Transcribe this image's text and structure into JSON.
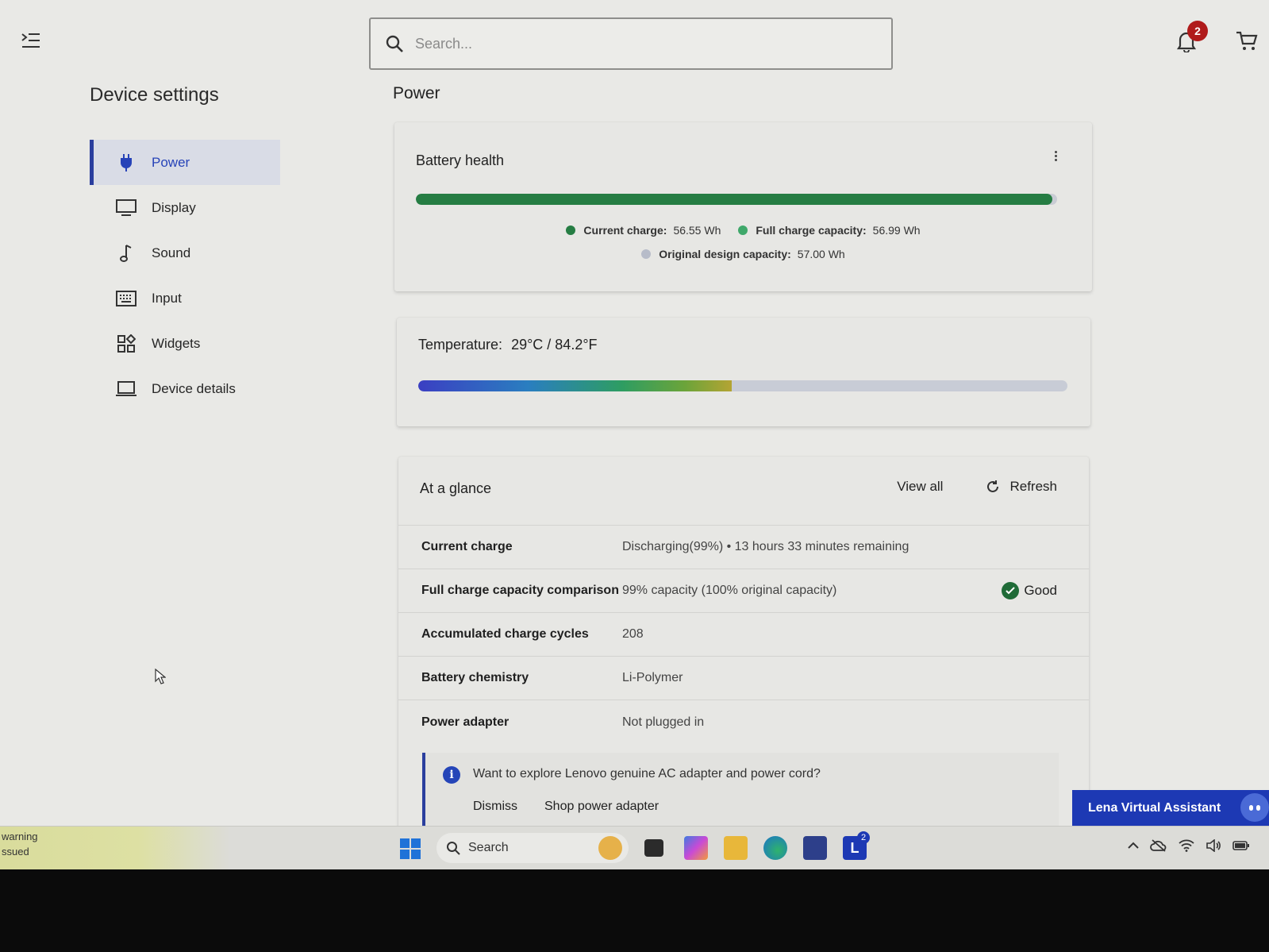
{
  "topbar": {
    "search_placeholder": "Search...",
    "notification_count": "2"
  },
  "sidebar": {
    "title": "Device settings",
    "items": [
      {
        "label": "Power",
        "icon": "plug-icon",
        "active": true
      },
      {
        "label": "Display",
        "icon": "monitor-icon"
      },
      {
        "label": "Sound",
        "icon": "music-note-icon"
      },
      {
        "label": "Input",
        "icon": "keyboard-icon"
      },
      {
        "label": "Widgets",
        "icon": "widgets-icon"
      },
      {
        "label": "Device details",
        "icon": "laptop-icon"
      }
    ]
  },
  "page": {
    "title": "Power"
  },
  "battery_health": {
    "title": "Battery health",
    "charge_fraction": 0.992,
    "legend": [
      {
        "label": "Current charge:",
        "value": "56.55 Wh",
        "color": "#267d43"
      },
      {
        "label": "Full charge capacity:",
        "value": "56.99 Wh",
        "color": "#3fa86a"
      },
      {
        "label": "Original design capacity:",
        "value": "57.00 Wh",
        "color": "#b7bcc9"
      }
    ]
  },
  "temperature": {
    "title": "Temperature:",
    "value": "29°C / 84.2°F",
    "level_fraction": 0.483
  },
  "at_a_glance": {
    "title": "At a glance",
    "view_all": "View all",
    "refresh": "Refresh",
    "rows": [
      {
        "label": "Current charge",
        "value": "Discharging(99%)  •  13 hours 33 minutes remaining"
      },
      {
        "label": "Full charge capacity comparison",
        "value": "99% capacity (100% original capacity)",
        "status": "Good"
      },
      {
        "label": "Accumulated charge cycles",
        "value": "208"
      },
      {
        "label": "Battery chemistry",
        "value": "Li-Polymer"
      },
      {
        "label": "Power adapter",
        "value": "Not plugged in"
      }
    ],
    "info": {
      "text": "Want to explore Lenovo genuine AC adapter and power cord?",
      "dismiss": "Dismiss",
      "shop": "Shop power adapter"
    }
  },
  "assistant": {
    "label": "Lena Virtual Assistant"
  },
  "taskbar": {
    "warning_line1": "warning",
    "warning_line2": "ssued",
    "search_label": "Search",
    "vantage_badge": "2"
  }
}
